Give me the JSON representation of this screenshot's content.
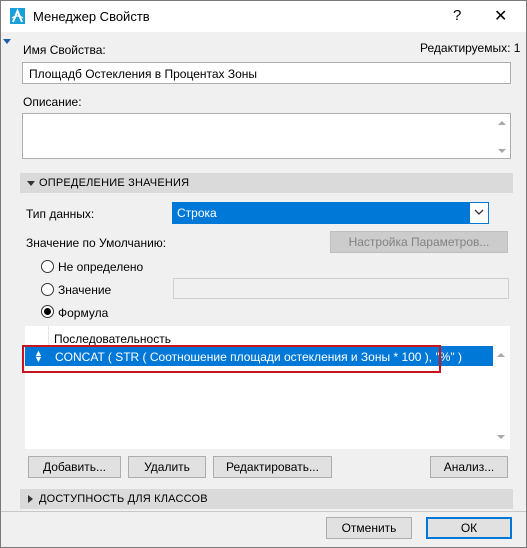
{
  "window": {
    "title": "Менеджер Свойств",
    "help_glyph": "?",
    "close_glyph": "✕",
    "app_icon": "archicad-icon"
  },
  "header": {
    "property_name_label": "Имя Свойства:",
    "editable_label": "Редактируемых: 1",
    "property_name_value": "Площадб Остекления в Процентах Зоны",
    "description_label": "Описание:",
    "description_value": ""
  },
  "value_definition": {
    "section_title": "ОПРЕДЕЛЕНИЕ ЗНАЧЕНИЯ",
    "data_type_label": "Тип данных:",
    "data_type_value": "Строка",
    "default_value_label": "Значение по Умолчанию:",
    "settings_button": "Настройка Параметров...",
    "options": [
      {
        "label": "Не определено",
        "selected": false
      },
      {
        "label": "Значение",
        "selected": false
      },
      {
        "label": "Формула",
        "selected": true
      }
    ],
    "value_field": "",
    "list": {
      "header": "Последовательность",
      "rows": [
        {
          "text": "CONCAT ( STR ( Соотношение площади остекления и Зоны * 100 ), \"%\" )",
          "selected": true
        }
      ]
    },
    "buttons": {
      "add": "Добавить...",
      "delete": "Удалить",
      "edit": "Редактировать...",
      "analyze": "Анализ..."
    }
  },
  "availability": {
    "section_title": "ДОСТУПНОСТЬ ДЛЯ КЛАССОВ"
  },
  "footer": {
    "cancel": "Отменить",
    "ok": "ОК"
  },
  "colors": {
    "accent": "#0078d7",
    "highlight_outline": "#c8141e",
    "section_header": "#dadada"
  }
}
